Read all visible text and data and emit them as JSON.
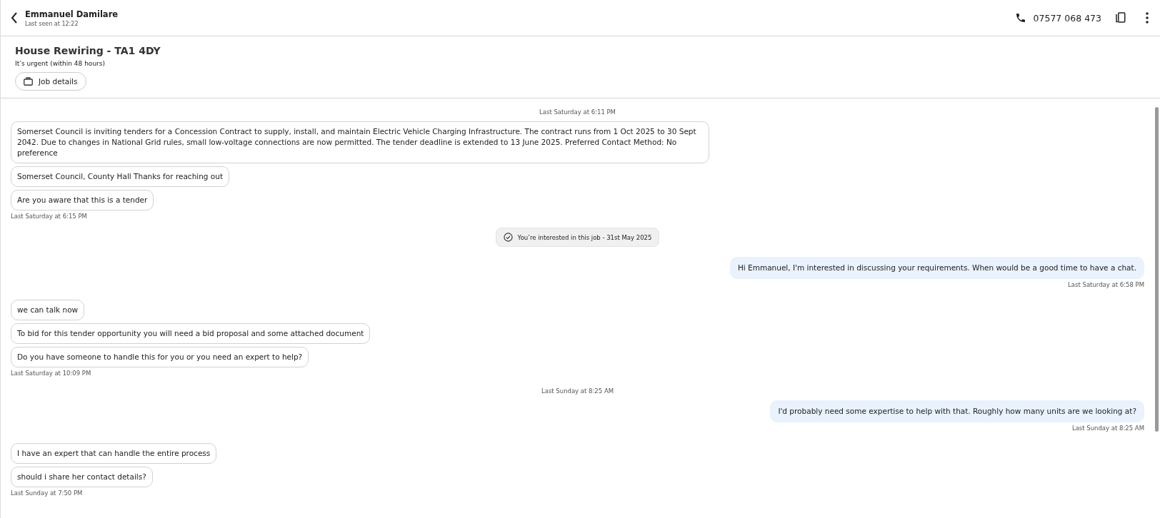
{
  "contact": {
    "name": "Emmanuel Damilare",
    "last_seen": "Last seen at 12:22",
    "phone": "07577 068 473"
  },
  "job": {
    "title": "House Rewiring - TA1 4DY",
    "urgency": "It’s urgent (within 48 hours)",
    "details_button": "Job details"
  },
  "messages": [
    {
      "kind": "divider",
      "text": "Last Saturday at 6:11 PM"
    },
    {
      "kind": "message",
      "outgoing": false,
      "text": "Somerset Council is inviting tenders for a Concession Contract to supply, install, and maintain Electric Vehicle Charging Infrastructure. The contract runs from 1 Oct 2025 to 30 Sept 2042. Due to changes in National Grid rules, small low-voltage connections are now permitted. The tender deadline is extended to 13 June 2025. Preferred Contact Method: No preference"
    },
    {
      "kind": "message",
      "outgoing": false,
      "text": "Somerset Council, County Hall Thanks for reaching out"
    },
    {
      "kind": "message",
      "outgoing": false,
      "text": "Are you aware that this is a tender"
    },
    {
      "kind": "stamp",
      "outgoing": false,
      "text": "Last Saturday at 6:15 PM"
    },
    {
      "kind": "event",
      "text": "You’re interested in this job - 31st May 2025"
    },
    {
      "kind": "message",
      "outgoing": true,
      "text": "Hi Emmanuel, I'm interested in discussing your requirements. When would be a good time to have a chat."
    },
    {
      "kind": "stamp",
      "outgoing": true,
      "text": "Last Saturday at 6:58 PM"
    },
    {
      "kind": "message",
      "outgoing": false,
      "text": "we can talk now"
    },
    {
      "kind": "message",
      "outgoing": false,
      "text": "To bid for this tender opportunity you will need a bid proposal and some attached document"
    },
    {
      "kind": "message",
      "outgoing": false,
      "text": "Do you have someone to handle this for you or you need an expert to help?"
    },
    {
      "kind": "stamp",
      "outgoing": false,
      "text": "Last Saturday at 10:09 PM"
    },
    {
      "kind": "divider",
      "text": "Last Sunday at 8:25 AM"
    },
    {
      "kind": "message",
      "outgoing": true,
      "text": "I'd probably need some expertise to help with that. Roughly how many units are we looking at?"
    },
    {
      "kind": "stamp",
      "outgoing": true,
      "text": "Last Sunday at 8:25 AM"
    },
    {
      "kind": "message",
      "outgoing": false,
      "text": "I have an expert that can handle the entire process"
    },
    {
      "kind": "message",
      "outgoing": false,
      "text": "should i share her contact details?"
    },
    {
      "kind": "stamp",
      "outgoing": false,
      "text": "Last Sunday at 7:50 PM"
    }
  ]
}
